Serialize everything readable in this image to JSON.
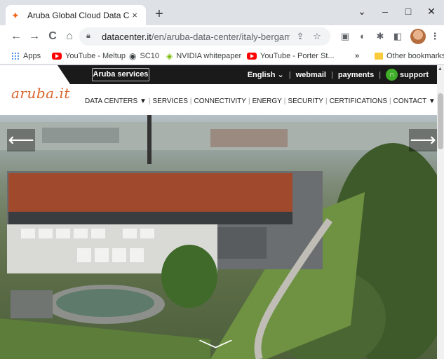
{
  "browser": {
    "tab_title": "Aruba Global Cloud Data Center",
    "tab_close": "×",
    "new_tab": "+",
    "window_controls": {
      "minimize": "–",
      "maximize": "□",
      "close": "✕",
      "tabsearch": "⌄"
    },
    "url_host": "datacenter.it",
    "url_path": "/en/aruba-data-center/italy-bergamo-d...",
    "nav_icons": {
      "back": "←",
      "forward": "→",
      "reload": "C",
      "home": "⌂"
    },
    "bookmarks": [
      {
        "label": "Apps",
        "icon": "apps-icon"
      },
      {
        "label": "YouTube - Meltup",
        "icon": "youtube-icon"
      },
      {
        "label": "SC10",
        "icon": "globe-icon"
      },
      {
        "label": "NVIDIA whitepaper",
        "icon": "nvidia-icon"
      },
      {
        "label": "YouTube - Porter St...",
        "icon": "youtube-icon"
      }
    ],
    "bookmarks_overflow": "»",
    "other_bookmarks": "Other bookmarks"
  },
  "site": {
    "services_button": "Aruba services",
    "language": "English",
    "language_caret": "⌄",
    "links": [
      "webmail",
      "payments"
    ],
    "support": "support",
    "logo": "aruba.it",
    "nav": [
      {
        "label": "DATA CENTERS",
        "dropdown": "▼"
      },
      {
        "label": "SERVICES"
      },
      {
        "label": "CONNECTIVITY"
      },
      {
        "label": "ENERGY"
      },
      {
        "label": "SECURITY"
      },
      {
        "label": "CERTIFICATIONS"
      },
      {
        "label": "CONTACT",
        "dropdown": "▼"
      }
    ],
    "hero_prev": "⟵",
    "hero_next": "⟶",
    "hero_down": "⌵"
  },
  "colors": {
    "brand_orange": "#d9652b",
    "topbar_dark": "#1a1a1a",
    "support_green": "#3fae29"
  }
}
